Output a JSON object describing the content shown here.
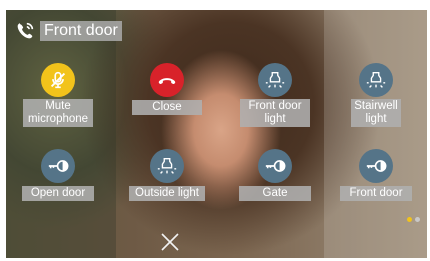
{
  "header": {
    "title": "Front door"
  },
  "buttons": {
    "mute": "Mute microphone",
    "close": "Close",
    "front_light": "Front door light",
    "stairwell_light": "Stairwell light",
    "open_door": "Open door",
    "outside_light": "Outside light",
    "gate": "Gate",
    "front_door": "Front door"
  },
  "icons": {
    "call": "phone-call-icon",
    "mute": "microphone-muted-icon",
    "close": "hang-up-icon",
    "light": "light-bulb-icon",
    "lock": "key-lock-icon",
    "dismiss": "close-x-icon"
  },
  "pagination": {
    "pages": 2,
    "current": 1
  },
  "colors": {
    "mute": "#f2c31b",
    "close": "#d8222a",
    "action": "#557488",
    "label_bg": "#afafaf",
    "dot_active": "#f2c31b",
    "dot_inactive": "#c8c8c8"
  }
}
